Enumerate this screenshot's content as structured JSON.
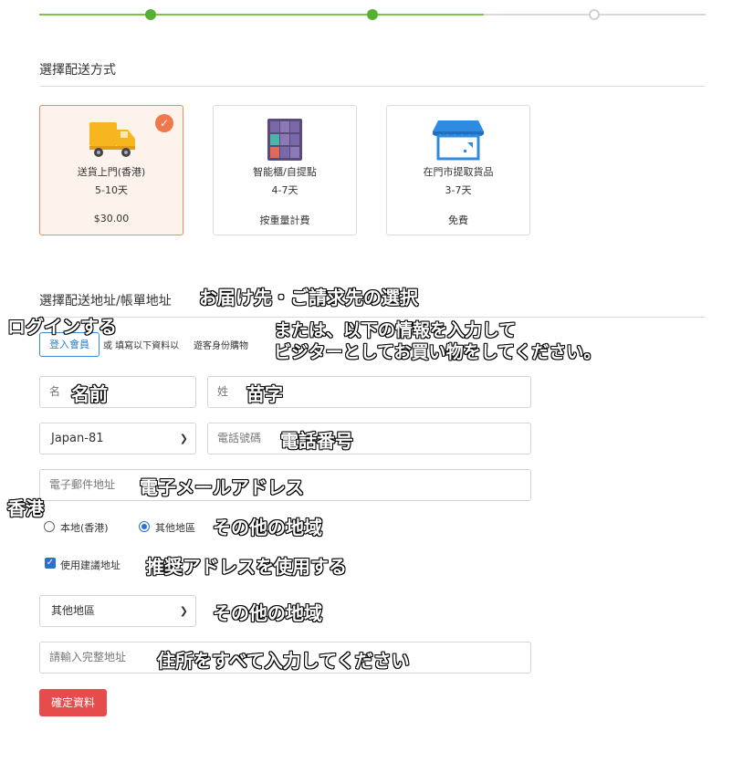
{
  "progress": {
    "steps_done": 2,
    "steps_total": 3
  },
  "shipping": {
    "title": "選擇配送方式",
    "options": [
      {
        "name": "送貨上門(香港)",
        "days": "5-10天",
        "price": "$30.00",
        "icon": "truck-icon",
        "selected": true
      },
      {
        "name": "智能櫃/自提點",
        "days": "4-7天",
        "price": "按重量計費",
        "icon": "locker-icon",
        "selected": false
      },
      {
        "name": "在門市提取貨品",
        "days": "3-7天",
        "price": "免費",
        "icon": "store-icon",
        "selected": false
      }
    ]
  },
  "address": {
    "title": "選擇配送地址/帳單地址",
    "login_button": "登入會員",
    "or_text": "或 填寫以下資料以",
    "guest_text": "遊客身份購物",
    "first_name_placeholder": "名",
    "last_name_placeholder": "姓",
    "country_code": "Japan-81",
    "phone_placeholder": "電話號碼",
    "email_placeholder": "電子郵件地址",
    "region_local": "本地(香港)",
    "region_other": "其他地區",
    "region_selected": "其他地區",
    "use_suggested": "使用建議地址",
    "use_suggested_checked": true,
    "region_select_value": "其他地區",
    "full_address_placeholder": "請輸入完整地址",
    "confirm_button": "確定資料"
  },
  "overlay": {
    "address_title": "お届け先・ご請求先の選択",
    "login": "ログインする",
    "guest_line1": "または、以下の情報を入力して",
    "guest_line2": "ビジターとしてお買い物をしてください。",
    "first_name": "名前",
    "last_name": "苗字",
    "phone": "電話番号",
    "email": "電子メールアドレス",
    "hongkong": "香港",
    "other_region": "その他の地域",
    "use_suggested": "推奨アドレスを使用する",
    "other_region_select": "その他の地域",
    "full_address": "住所をすべて入力してください"
  },
  "colors": {
    "accent_green": "#55b032",
    "selected_border": "#f08b5e",
    "confirm_red": "#e74c4c",
    "link_blue": "#2f7fcf"
  }
}
